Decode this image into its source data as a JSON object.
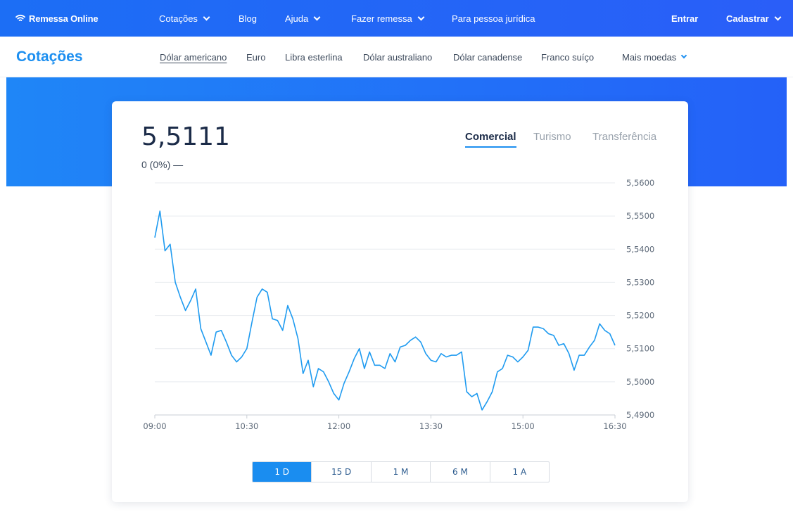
{
  "brand": {
    "name": "Remessa Online"
  },
  "topnav": {
    "items": [
      {
        "label": "Cotações",
        "dropdown": true
      },
      {
        "label": "Blog",
        "dropdown": false
      },
      {
        "label": "Ajuda",
        "dropdown": true
      },
      {
        "label": "Fazer remessa",
        "dropdown": true
      },
      {
        "label": "Para pessoa jurídica",
        "dropdown": false
      }
    ],
    "login": "Entrar",
    "signup": "Cadastrar"
  },
  "subnav": {
    "title": "Cotações",
    "currencies": [
      "Dólar americano",
      "Euro",
      "Libra esterlina",
      "Dólar australiano",
      "Dólar canadense",
      "Franco suíço"
    ],
    "more": "Mais moedas",
    "active_currency": "Dólar americano"
  },
  "quote": {
    "price": "5,5111",
    "change": "0 (0%)",
    "change_symbol": "—",
    "tabs": [
      "Comercial",
      "Turismo",
      "Transferência"
    ],
    "active_tab": "Comercial"
  },
  "ranges": {
    "buttons": [
      "1 D",
      "15 D",
      "1 M",
      "6 M",
      "1 A"
    ],
    "active": "1 D"
  },
  "colors": {
    "nav": "#1c6ef5",
    "accent": "#1d8ff0",
    "line": "#1f9bf0"
  },
  "chart_data": {
    "type": "line",
    "x_ticks": [
      "09:00",
      "10:30",
      "12:00",
      "13:30",
      "15:00",
      "16:30"
    ],
    "y_ticks": [
      "5,5600",
      "5,5500",
      "5,5400",
      "5,5300",
      "5,5200",
      "5,5100",
      "5,5000",
      "5,4900"
    ],
    "ylim": [
      5.49,
      5.56
    ],
    "xlim_minutes": [
      0,
      450
    ],
    "grid": true,
    "series": [
      {
        "x": [
          0,
          5,
          10,
          15,
          20,
          25,
          30,
          35,
          40,
          45,
          50,
          55,
          60,
          65,
          70,
          75,
          80,
          85,
          90,
          95,
          100,
          105,
          110,
          115,
          120,
          125,
          130,
          135,
          140,
          145,
          150,
          155,
          160,
          165,
          170,
          175,
          180,
          185,
          190,
          195,
          200,
          205,
          210,
          215,
          220,
          225,
          230,
          235,
          240,
          245,
          250,
          255,
          260,
          265,
          270,
          275,
          280,
          285,
          290,
          295,
          300,
          305,
          310,
          315,
          320,
          325,
          330,
          335,
          340,
          345,
          350,
          355,
          360,
          365,
          370,
          375,
          380,
          385,
          390,
          395,
          400,
          405,
          410,
          415,
          420,
          425,
          430,
          435,
          440,
          445,
          450
        ],
        "y": [
          5.5435,
          5.5515,
          5.5395,
          5.5415,
          5.53,
          5.5255,
          5.5215,
          5.5245,
          5.528,
          5.516,
          5.512,
          5.508,
          5.515,
          5.5155,
          5.512,
          5.508,
          5.506,
          5.5075,
          5.51,
          5.518,
          5.5255,
          5.528,
          5.527,
          5.519,
          5.5185,
          5.5155,
          5.523,
          5.519,
          5.513,
          5.5025,
          5.5065,
          5.4985,
          5.504,
          5.503,
          5.5,
          5.4965,
          5.4945,
          5.4995,
          5.503,
          5.507,
          5.51,
          5.504,
          5.509,
          5.505,
          5.505,
          5.504,
          5.5085,
          5.506,
          5.5105,
          5.511,
          5.5125,
          5.5135,
          5.512,
          5.5085,
          5.5065,
          5.506,
          5.5085,
          5.5075,
          5.508,
          5.508,
          5.509,
          5.497,
          5.4955,
          5.4965,
          5.4915,
          5.494,
          5.497,
          5.503,
          5.504,
          5.508,
          5.5075,
          5.506,
          5.5075,
          5.5095,
          5.5165,
          5.5165,
          5.516,
          5.5145,
          5.514,
          5.511,
          5.5115,
          5.5085,
          5.5035,
          5.508,
          5.508,
          5.5105,
          5.5125,
          5.5175,
          5.5155,
          5.5145,
          5.511
        ]
      }
    ]
  }
}
